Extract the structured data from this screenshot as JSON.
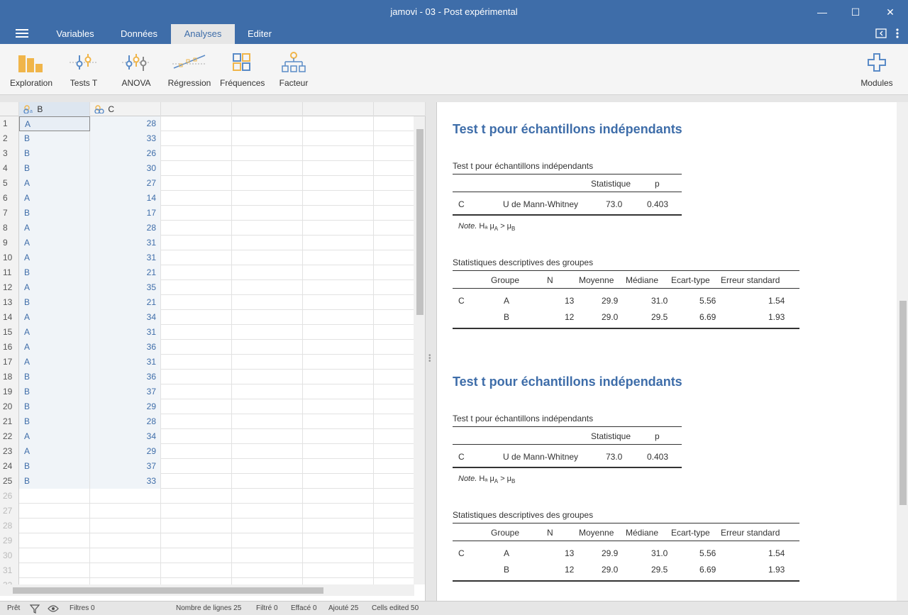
{
  "window": {
    "title": "jamovi - 03 - Post expérimental"
  },
  "menu": {
    "tabs": [
      "Variables",
      "Données",
      "Analyses",
      "Editer"
    ],
    "active": "Analyses"
  },
  "ribbon": {
    "buttons": [
      "Exploration",
      "Tests T",
      "ANOVA",
      "Régression",
      "Fréquences",
      "Facteur"
    ],
    "modules": "Modules"
  },
  "grid": {
    "columns": [
      "B",
      "C"
    ],
    "rows": [
      {
        "n": "1",
        "b": "A",
        "c": "28"
      },
      {
        "n": "2",
        "b": "B",
        "c": "33"
      },
      {
        "n": "3",
        "b": "B",
        "c": "26"
      },
      {
        "n": "4",
        "b": "B",
        "c": "30"
      },
      {
        "n": "5",
        "b": "A",
        "c": "27"
      },
      {
        "n": "6",
        "b": "A",
        "c": "14"
      },
      {
        "n": "7",
        "b": "B",
        "c": "17"
      },
      {
        "n": "8",
        "b": "A",
        "c": "28"
      },
      {
        "n": "9",
        "b": "A",
        "c": "31"
      },
      {
        "n": "10",
        "b": "A",
        "c": "31"
      },
      {
        "n": "11",
        "b": "B",
        "c": "21"
      },
      {
        "n": "12",
        "b": "A",
        "c": "35"
      },
      {
        "n": "13",
        "b": "B",
        "c": "21"
      },
      {
        "n": "14",
        "b": "A",
        "c": "34"
      },
      {
        "n": "15",
        "b": "A",
        "c": "31"
      },
      {
        "n": "16",
        "b": "A",
        "c": "36"
      },
      {
        "n": "17",
        "b": "A",
        "c": "31"
      },
      {
        "n": "18",
        "b": "B",
        "c": "36"
      },
      {
        "n": "19",
        "b": "B",
        "c": "37"
      },
      {
        "n": "20",
        "b": "B",
        "c": "29"
      },
      {
        "n": "21",
        "b": "B",
        "c": "28"
      },
      {
        "n": "22",
        "b": "A",
        "c": "34"
      },
      {
        "n": "23",
        "b": "A",
        "c": "29"
      },
      {
        "n": "24",
        "b": "B",
        "c": "37"
      },
      {
        "n": "25",
        "b": "B",
        "c": "33"
      }
    ],
    "empty_rows": [
      "26",
      "27",
      "28",
      "29",
      "30",
      "31",
      "32"
    ]
  },
  "status": {
    "ready": "Prêt",
    "filters": "Filtres 0",
    "row_count": "Nombre de lignes 25",
    "filtered": "Filtré 0",
    "deleted": "Effacé 0",
    "added": "Ajouté 25",
    "edited": "Cells edited 50"
  },
  "results": [
    {
      "heading": "Test t pour échantillons indépendants",
      "ttest": {
        "caption": "Test t pour échantillons indépendants",
        "headers": [
          "",
          "",
          "Statistique",
          "p"
        ],
        "row": [
          "C",
          "U de Mann-Whitney",
          "73.0",
          "0.403"
        ],
        "note_label": "Note.",
        "note_text": "Hₐ μ",
        "note_a": "A",
        "note_gt": " > μ",
        "note_b": "B"
      },
      "desc": {
        "caption": "Statistiques descriptives des groupes",
        "headers": [
          "",
          "Groupe",
          "N",
          "Moyenne",
          "Médiane",
          "Ecart-type",
          "Erreur standard"
        ],
        "rows": [
          [
            "C",
            "A",
            "13",
            "29.9",
            "31.0",
            "5.56",
            "1.54"
          ],
          [
            "",
            "B",
            "12",
            "29.0",
            "29.5",
            "6.69",
            "1.93"
          ]
        ]
      }
    },
    {
      "heading": "Test t pour échantillons indépendants",
      "ttest": {
        "caption": "Test t pour échantillons indépendants",
        "headers": [
          "",
          "",
          "Statistique",
          "p"
        ],
        "row": [
          "C",
          "U de Mann-Whitney",
          "73.0",
          "0.403"
        ],
        "note_label": "Note.",
        "note_text": "Hₐ μ",
        "note_a": "A",
        "note_gt": " > μ",
        "note_b": "B"
      },
      "desc": {
        "caption": "Statistiques descriptives des groupes",
        "headers": [
          "",
          "Groupe",
          "N",
          "Moyenne",
          "Médiane",
          "Ecart-type",
          "Erreur standard"
        ],
        "rows": [
          [
            "C",
            "A",
            "13",
            "29.9",
            "31.0",
            "5.56",
            "1.54"
          ],
          [
            "",
            "B",
            "12",
            "29.0",
            "29.5",
            "6.69",
            "1.93"
          ]
        ]
      }
    }
  ]
}
